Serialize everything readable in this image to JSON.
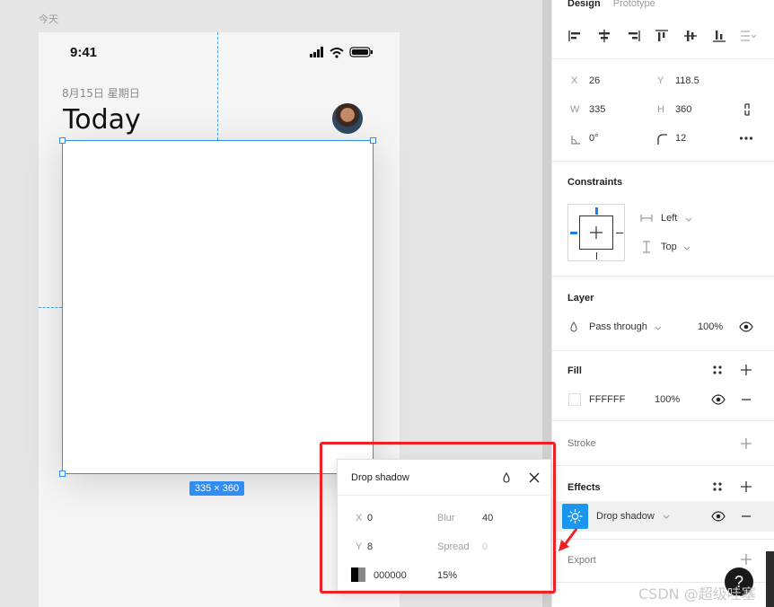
{
  "canvas": {
    "frame_label": "今天",
    "status_time": "9:41",
    "date_text": "8月15日 星期日",
    "title": "Today",
    "size_badge": "335 × 360"
  },
  "panel": {
    "tabs": {
      "design": "Design",
      "prototype": "Prototype"
    },
    "position": {
      "x_label": "X",
      "x_value": "26",
      "y_label": "Y",
      "y_value": "118.5"
    },
    "size": {
      "w_label": "W",
      "w_value": "335",
      "h_label": "H",
      "h_value": "360"
    },
    "rotation": {
      "value": "0°"
    },
    "radius": {
      "value": "12"
    },
    "constraints": {
      "title": "Constraints",
      "horizontal": "Left",
      "vertical": "Top"
    },
    "layer": {
      "title": "Layer",
      "blend": "Pass through",
      "opacity": "100%"
    },
    "fill": {
      "title": "Fill",
      "hex": "FFFFFF",
      "opacity": "100%"
    },
    "stroke": {
      "title": "Stroke"
    },
    "effects": {
      "title": "Effects",
      "effect_name": "Drop shadow"
    },
    "export": {
      "title": "Export"
    }
  },
  "popover": {
    "title": "Drop shadow",
    "x_label": "X",
    "x_value": "0",
    "blur_label": "Blur",
    "blur_value": "40",
    "y_label": "Y",
    "y_value": "8",
    "spread_label": "Spread",
    "spread_value": "0",
    "color_hex": "000000",
    "color_opacity": "15%"
  },
  "overlay": {
    "help": "?",
    "watermark": "CSDN @超级哇塞"
  },
  "colors": {
    "selection": "#2f8df3",
    "annotation": "#ee2222",
    "effect_icon": "#1a96f0"
  }
}
